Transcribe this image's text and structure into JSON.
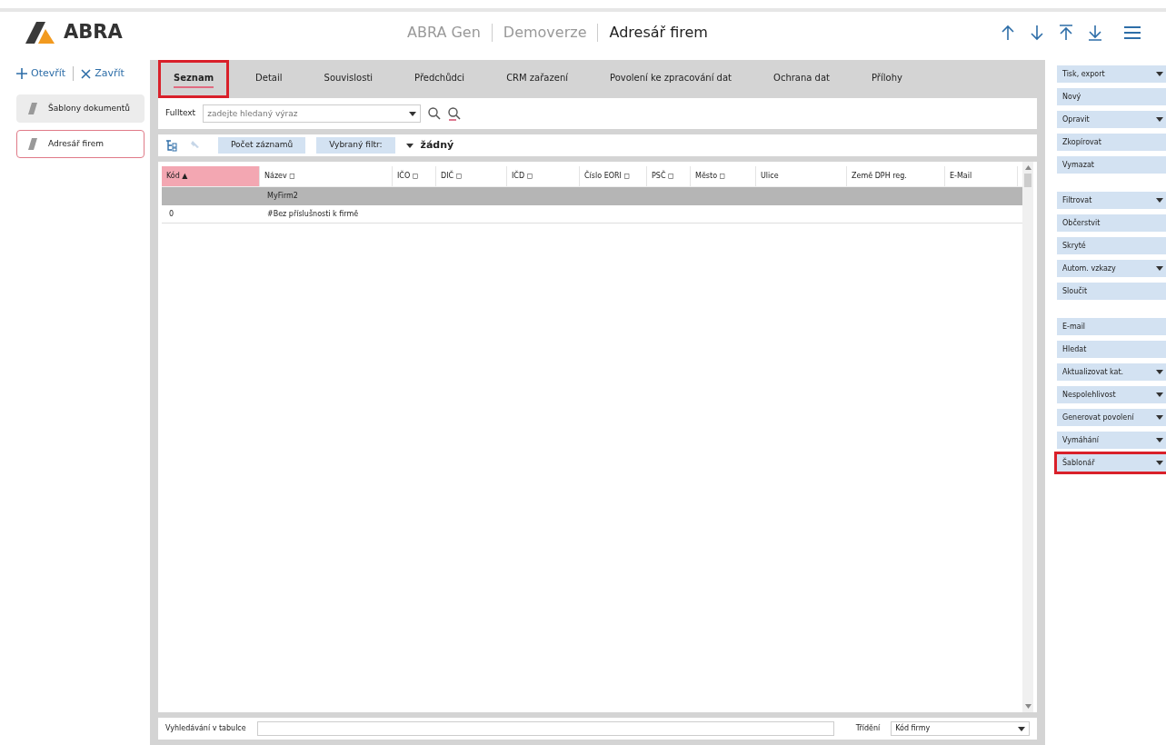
{
  "header": {
    "logo": "ABRA",
    "breadcrumb": [
      "ABRA Gen",
      "Demoverze",
      "Adresář firem"
    ]
  },
  "left_panel": {
    "open": "Otevřít",
    "close": "Zavřít",
    "items": [
      {
        "label": "Šablony dokumentů",
        "selected": false
      },
      {
        "label": "Adresář firem",
        "selected": true
      }
    ]
  },
  "tabs": [
    {
      "label": "Seznam",
      "selected": true,
      "highlighted": true
    },
    {
      "label": "Detail",
      "selected": false,
      "highlighted": false
    },
    {
      "label": "Souvislosti",
      "selected": false,
      "highlighted": false
    },
    {
      "label": "Předchůdci",
      "selected": false,
      "highlighted": false
    },
    {
      "label": "CRM zařazení",
      "selected": false,
      "highlighted": false
    },
    {
      "label": "Povolení ke zpracování dat",
      "selected": false,
      "highlighted": false
    },
    {
      "label": "Ochrana dat",
      "selected": false,
      "highlighted": false
    },
    {
      "label": "Přílohy",
      "selected": false,
      "highlighted": false
    }
  ],
  "fulltext": {
    "label": "Fulltext",
    "placeholder": "zadejte hledaný výraz"
  },
  "toolbar": {
    "count_button": "Počet záznamů",
    "filter_button": "Vybraný filtr:",
    "filter_value": "žádný"
  },
  "table": {
    "columns": [
      {
        "label": "Kód ▲",
        "sorted": true
      },
      {
        "label": "Název ◻",
        "sorted": false
      },
      {
        "label": "IČO ◻",
        "sorted": false
      },
      {
        "label": "DIČ ◻",
        "sorted": false
      },
      {
        "label": "IČD ◻",
        "sorted": false
      },
      {
        "label": "Číslo EORI ◻",
        "sorted": false
      },
      {
        "label": "PSČ ◻",
        "sorted": false
      },
      {
        "label": "Město ◻",
        "sorted": false
      },
      {
        "label": "Ulice",
        "sorted": false
      },
      {
        "label": "Země DPH reg.",
        "sorted": false
      },
      {
        "label": "E-Mail",
        "sorted": false
      }
    ],
    "rows": [
      {
        "kind": "group",
        "cells": [
          "",
          "MyFirm2"
        ]
      },
      {
        "kind": "row",
        "cells": [
          "0",
          "#Bez příslušnosti k firmě"
        ]
      }
    ]
  },
  "bottom_bar": {
    "search_label": "Vyhledávání v tabulce",
    "sort_label": "Třídění",
    "sort_value": "Kód firmy"
  },
  "action_groups": [
    [
      {
        "label": "Tisk, export",
        "dropdown": true,
        "highlighted": false
      },
      {
        "label": "Nový",
        "dropdown": false,
        "highlighted": false
      },
      {
        "label": "Opravit",
        "dropdown": true,
        "highlighted": false
      },
      {
        "label": "Zkopírovat",
        "dropdown": false,
        "highlighted": false
      },
      {
        "label": "Vymazat",
        "dropdown": false,
        "highlighted": false
      }
    ],
    [
      {
        "label": "Filtrovat",
        "dropdown": true,
        "highlighted": false
      },
      {
        "label": "Občerstvit",
        "dropdown": false,
        "highlighted": false
      },
      {
        "label": "Skryté",
        "dropdown": false,
        "highlighted": false
      },
      {
        "label": "Autom. vzkazy",
        "dropdown": true,
        "highlighted": false
      },
      {
        "label": "Sloučit",
        "dropdown": false,
        "highlighted": false
      }
    ],
    [
      {
        "label": "E-mail",
        "dropdown": false,
        "highlighted": false
      },
      {
        "label": "Hledat",
        "dropdown": false,
        "highlighted": false
      },
      {
        "label": "Aktualizovat kat.",
        "dropdown": true,
        "highlighted": false
      },
      {
        "label": "Nespolehlivost",
        "dropdown": true,
        "highlighted": false
      },
      {
        "label": "Generovat povolení",
        "dropdown": true,
        "highlighted": false
      },
      {
        "label": "Vymáhání",
        "dropdown": true,
        "highlighted": false
      },
      {
        "label": "Šablonář",
        "dropdown": true,
        "highlighted": true
      }
    ]
  ]
}
